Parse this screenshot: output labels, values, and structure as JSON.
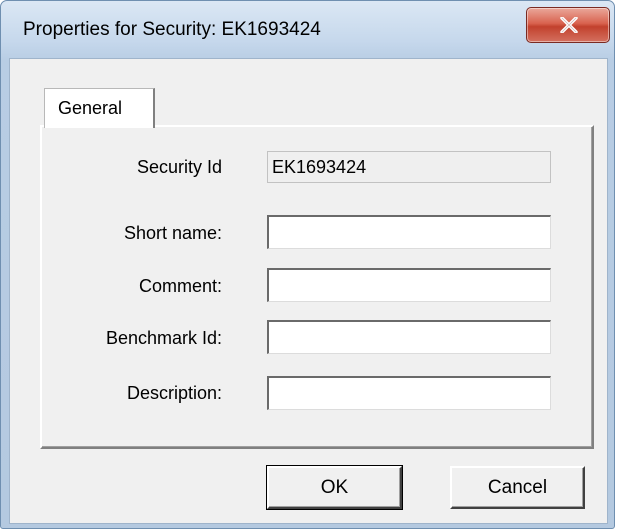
{
  "window": {
    "title": "Properties for Security: EK1693424",
    "close_icon": "close-icon"
  },
  "tabs": [
    {
      "label": "General",
      "selected": true
    }
  ],
  "fields": {
    "security_id": {
      "label": "Security Id",
      "value": "EK1693424",
      "readonly": true
    },
    "short_name": {
      "label": "Short name:",
      "value": ""
    },
    "comment": {
      "label": "Comment:",
      "value": ""
    },
    "benchmark_id": {
      "label": "Benchmark Id:",
      "value": ""
    },
    "description": {
      "label": "Description:",
      "value": ""
    }
  },
  "buttons": {
    "ok": "OK",
    "cancel": "Cancel"
  },
  "colors": {
    "close_button": "#c94a36",
    "frame": "#b8cde4",
    "client": "#f0f0f0"
  }
}
